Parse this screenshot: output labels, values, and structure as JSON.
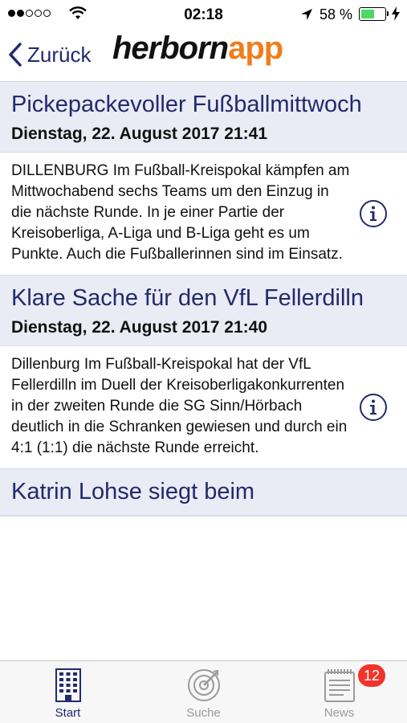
{
  "status_bar": {
    "time": "02:18",
    "battery_percent": "58 %",
    "battery_level": 0.58
  },
  "nav": {
    "back_label": "Zurück",
    "logo_part1": "herborn",
    "logo_part2": "app"
  },
  "articles": [
    {
      "title": "Pickepackevoller Fußballmittwoch",
      "date": "Dienstag, 22. August 2017 21:41",
      "teaser": "DILLENBURG Im Fußball-Kreispokal kämpfen am Mittwochabend sechs Teams um den Einzug in die nächste Runde. In je einer Partie der Kreisoberliga, A-Liga und B-Liga geht es um Punkte. Auch die Fußballerinnen sind im Einsatz."
    },
    {
      "title": "Klare Sache für den VfL Fellerdilln",
      "date": "Dienstag, 22. August 2017 21:40",
      "teaser": "Dillenburg Im Fußball-Kreispokal hat der VfL Fellerdilln im Duell der Kreisoberligakonkurrenten in der zweiten Runde die SG Sinn/Hörbach deutlich in die Schranken gewiesen und durch ein 4:1 (1:1) die nächste Runde erreicht."
    },
    {
      "title": "Katrin Lohse siegt beim",
      "date": "",
      "teaser": ""
    }
  ],
  "tabs": [
    {
      "label": "Start",
      "icon": "building-icon",
      "active": true
    },
    {
      "label": "Suche",
      "icon": "search-target-icon",
      "active": false
    },
    {
      "label": "News",
      "icon": "newspaper-icon",
      "active": false,
      "badge": "12"
    }
  ],
  "colors": {
    "accent": "#232a6b",
    "brand_orange": "#f07d1c",
    "header_bg": "#e9ebf5",
    "badge": "#f2332a",
    "battery": "#4cd964"
  }
}
